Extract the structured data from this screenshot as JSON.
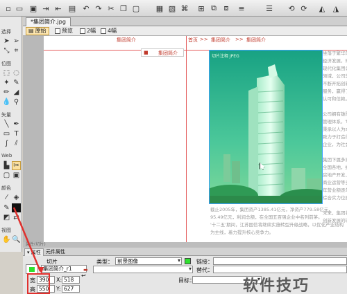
{
  "document": {
    "tab": "*集团简介.jpg"
  },
  "view_options": [
    {
      "label": "原始",
      "active": true
    },
    {
      "label": "预览",
      "active": false
    },
    {
      "label": "2幅",
      "active": false
    },
    {
      "label": "4幅",
      "active": false
    }
  ],
  "tools": {
    "sections": [
      "选择",
      "位图",
      "矢量",
      "Web",
      "颜色",
      "视图"
    ]
  },
  "page": {
    "nav_left": "集团简介",
    "nav_right_1": "首页",
    "nav_sep": ">>",
    "nav_right_2": "集团简介",
    "nav_sep2": ">>",
    "nav_right_3": "集团简介",
    "side_item": "集团简介",
    "photo_label": "切片注释 JPEG",
    "body_right": [
      "坐落于繁华的商业中心，集团总部大楼",
      "经济发展，现已成为一家大型的",
      "现代化集团公司，业务涵盖多个",
      "领域，公司坚持诚信经营，",
      "不断开拓创新，为客户提供优质",
      "服务，赢得了社会各界的广泛",
      "认可和信赖。",
      "",
      "公司拥有雄厚的实力，完善的",
      "管理体系，专业的团队，",
      "秉承以人为本的理念，",
      "致力于打造行业领先的",
      "企业，为社会创造更多价值。",
      "",
      "集团下属多家子公司，分布于",
      "全国各地，经营范围包括",
      "房地产开发、酒店管理、",
      "商业运营等多个领域，",
      "年营业额逐年递增，",
      "综合实力位居前列。",
      "",
      "未来，集团将继续秉承",
      "创新发展的理念，开拓进取。"
    ],
    "body_bottom": [
      "截止2005年，集团资产1385.41亿元，净资产779.58亿元，",
      "95.49亿元，利润总额，在全国五百强企业中名列前茅。",
      "'十二五'期间，江苏国信将继续实施转型升级战略，以优化产业结构为主线，着力提升核心竞争力。"
    ]
  },
  "properties": {
    "title": "属性(切片)",
    "tabs": [
      "属性",
      "元件属性"
    ],
    "object_kind": "切片",
    "object_name": "集团简介_r1",
    "type_label": "类型：",
    "type_value": "前景图像",
    "link_label": "链接：",
    "link_value": "",
    "alt_label": "替代：",
    "alt_value": "",
    "target_label": "目标：",
    "target_value": "",
    "w_label": "宽",
    "w_value": "390",
    "x_label": "X:",
    "x_value": "518",
    "h_label": "高",
    "h_value": "550",
    "y_label": "Y:",
    "y_value": "627",
    "slice_color": "#2fe02f"
  },
  "watermark": "软件技巧",
  "colors": {
    "accent_red": "#e0312e",
    "slice_blue": "#3aa1ff"
  }
}
